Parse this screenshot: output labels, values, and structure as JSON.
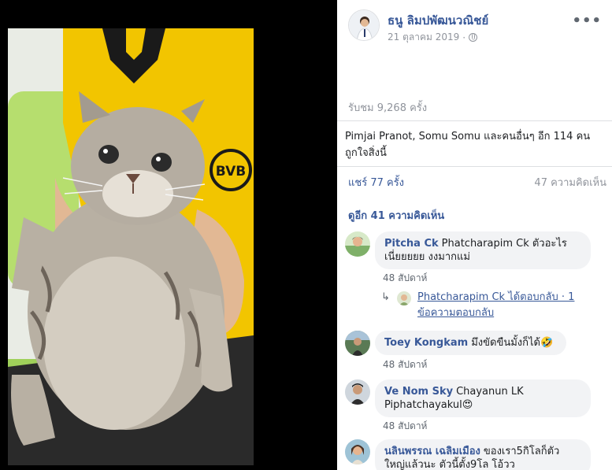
{
  "post": {
    "author": "ธนู ลิมปพัฒนวณิชย์",
    "date": "21 ตุลาคม 2019",
    "date_separator": "·",
    "more_menu": "•••",
    "views": "รับชม 9,268 ครั้ง",
    "likes_line1": "Pimjai Pranot, Somu Somu และคนอื่นๆ อีก 114 คน",
    "likes_line2": "ถูกใจสิ่งนี้",
    "shares": "แชร์ 77 ครั้ง",
    "comments_count": "47 ความคิดเห็น"
  },
  "comments": {
    "see_more": "ดูอีก 41 ความคิดเห็น",
    "items": [
      {
        "name": "Pitcha Ck",
        "text_line1": "Phatcharapim Ck ตัวอะไร",
        "text_line2": "เนี่ยยยยย งงมากแม่",
        "time": "48 สัปดาห์",
        "reply_line1": "Phatcharapim Ck ได้ตอบกลับ · 1",
        "reply_line2": "ข้อความตอบกลับ"
      },
      {
        "name": "Toey Kongkam",
        "text_line1": "มึงขัดขืนมั้งก็ได้🤣",
        "time": "48 สัปดาห์"
      },
      {
        "name": "Ve Nom Sky",
        "text_line1": "Chayanun LK",
        "text_line2": "Piphatchayakul😍",
        "time": "48 สัปดาห์"
      },
      {
        "name": "นลินพรรณ เฉลิมเมือง",
        "text_line1": "ของเรา5กิโลก็ตัว",
        "text_line2": "ใหญ่แล้วนะ ตัวนี้ตั้ง9โล โอ้วว"
      }
    ]
  },
  "icons": {
    "reply_arrow": "↳"
  },
  "colors": {
    "link": "#385898",
    "muted": "#90949c",
    "bubble": "#f2f3f5",
    "shirt": "#f2c500"
  }
}
